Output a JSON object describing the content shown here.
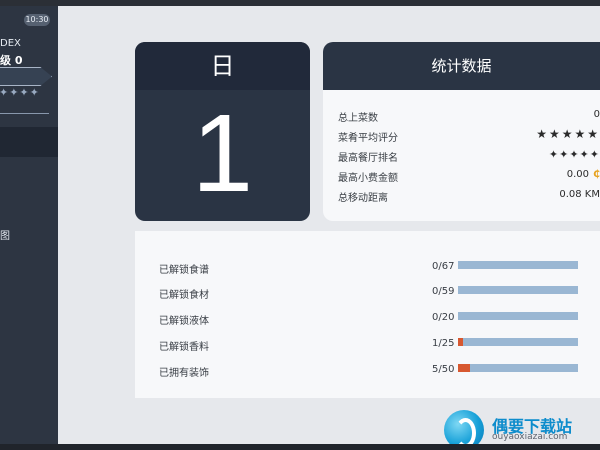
{
  "sidebar": {
    "time_badge": "10:30",
    "dex_label": "DEX",
    "level_label": "级 0",
    "level_stars": "✦✦✦✦",
    "active_item": "",
    "item_1": "",
    "item_2": "图"
  },
  "day_card": {
    "label": "日",
    "number": "1"
  },
  "stats": {
    "title": "统计数据",
    "rows": [
      {
        "label": "总上菜数",
        "value": "0"
      },
      {
        "label": "菜肴平均评分",
        "value": "★★★★★"
      },
      {
        "label": "最高餐厅排名",
        "value": "✦✦✦✦✦"
      },
      {
        "label": "最高小费金额",
        "value": "0.00"
      },
      {
        "label": "总移动距离",
        "value": "0.08 KM"
      }
    ]
  },
  "progress": [
    {
      "label": "已解锁食谱",
      "count": "0/67",
      "current": 0,
      "total": 67
    },
    {
      "label": "已解锁食材",
      "count": "0/59",
      "current": 0,
      "total": 59
    },
    {
      "label": "已解锁液体",
      "count": "0/20",
      "current": 0,
      "total": 20
    },
    {
      "label": "已解锁香料",
      "count": "1/25",
      "current": 1,
      "total": 25
    },
    {
      "label": "已拥有装饰",
      "count": "5/50",
      "current": 5,
      "total": 50
    }
  ],
  "watermark": {
    "name": "偶要下载站",
    "url": "ouyaoxiazai.com"
  },
  "colors": {
    "accent_gold": "#e6a321",
    "bar_fill": "#d75830",
    "bar_track": "#9ab7d3"
  }
}
